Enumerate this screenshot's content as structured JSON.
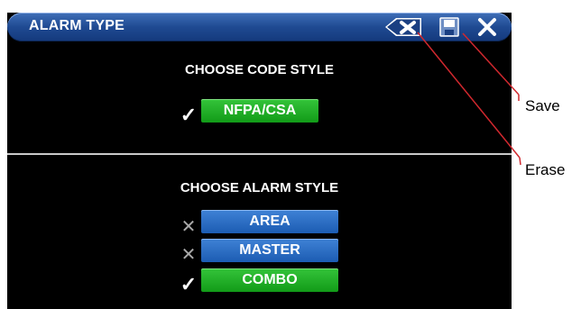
{
  "window": {
    "title": "ALARM TYPE"
  },
  "toolbar": {
    "erase_icon": "erase-icon",
    "save_icon": "save-icon",
    "close_icon": "close-icon"
  },
  "code_style": {
    "heading": "CHOOSE CODE STYLE",
    "options": [
      {
        "label": "NFPA/CSA",
        "selected": true
      }
    ]
  },
  "alarm_style": {
    "heading": "CHOOSE ALARM STYLE",
    "options": [
      {
        "label": "AREA",
        "selected": false
      },
      {
        "label": "MASTER",
        "selected": false
      },
      {
        "label": "COMBO",
        "selected": true
      }
    ]
  },
  "marks": {
    "check": "✓",
    "cross": "✕"
  },
  "callouts": {
    "save": "Save",
    "erase": "Erase"
  },
  "colors": {
    "titlebar": "#1f4a92",
    "selected_button": "#1fa524",
    "unselected_button": "#2b6cc4",
    "callout_line": "#d0282e"
  }
}
